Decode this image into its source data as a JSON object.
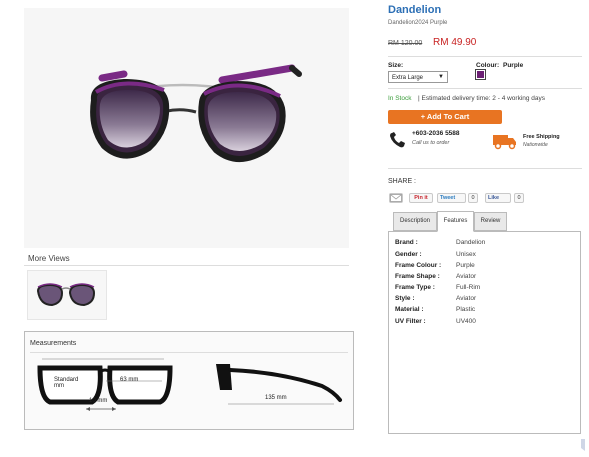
{
  "product": {
    "title": "Dandelion",
    "subtitle": "Dandelion2024 Purple",
    "old_price": "RM 120.00",
    "price": "RM 49.90"
  },
  "options": {
    "size_label": "Size:",
    "size_value": "Extra Large",
    "colour_label": "Colour:",
    "colour_value": "Purple",
    "colour_swatch": "#6b1f73"
  },
  "availability": {
    "stock": "In Stock",
    "delivery": "| Estimated delivery time: 2 - 4 working days"
  },
  "cart": {
    "label": "+ Add To Cart",
    "color": "#e87422"
  },
  "contact": {
    "phone": "+603-2036 5588",
    "phone_sub": "Call us to order",
    "shipping_title": "Free Shipping",
    "shipping_sub": "Nationwide"
  },
  "share": {
    "label": "SHARE :",
    "pin": "Pin it",
    "tweet": "Tweet",
    "tweet_count": "0",
    "like": "Like",
    "like_count": "0"
  },
  "tabs": [
    "Description",
    "Features",
    "Review"
  ],
  "active_tab": "Features",
  "features": [
    {
      "key": "Brand :",
      "value": "Dandelion"
    },
    {
      "key": "Gender :",
      "value": "Unisex"
    },
    {
      "key": "Frame Colour :",
      "value": "Purple"
    },
    {
      "key": "Frame Shape :",
      "value": "Aviator"
    },
    {
      "key": "Frame Type :",
      "value": "Full-Rim"
    },
    {
      "key": "Style :",
      "value": "Aviator"
    },
    {
      "key": "Material :",
      "value": "Plastic"
    },
    {
      "key": "UV Filter :",
      "value": "UV400"
    }
  ],
  "gallery": {
    "more_views": "More Views"
  },
  "measurements": {
    "title": "Measurements",
    "standard": "Standard",
    "standard_unit": "mm",
    "lens_width": "63 mm",
    "bridge": "10 mm",
    "temple": "135 mm"
  },
  "colors": {
    "title_blue": "#2c6fb5",
    "price_red": "#c82222",
    "stock_green": "#3a9c3a",
    "frame_purple": "#7a2a85"
  }
}
